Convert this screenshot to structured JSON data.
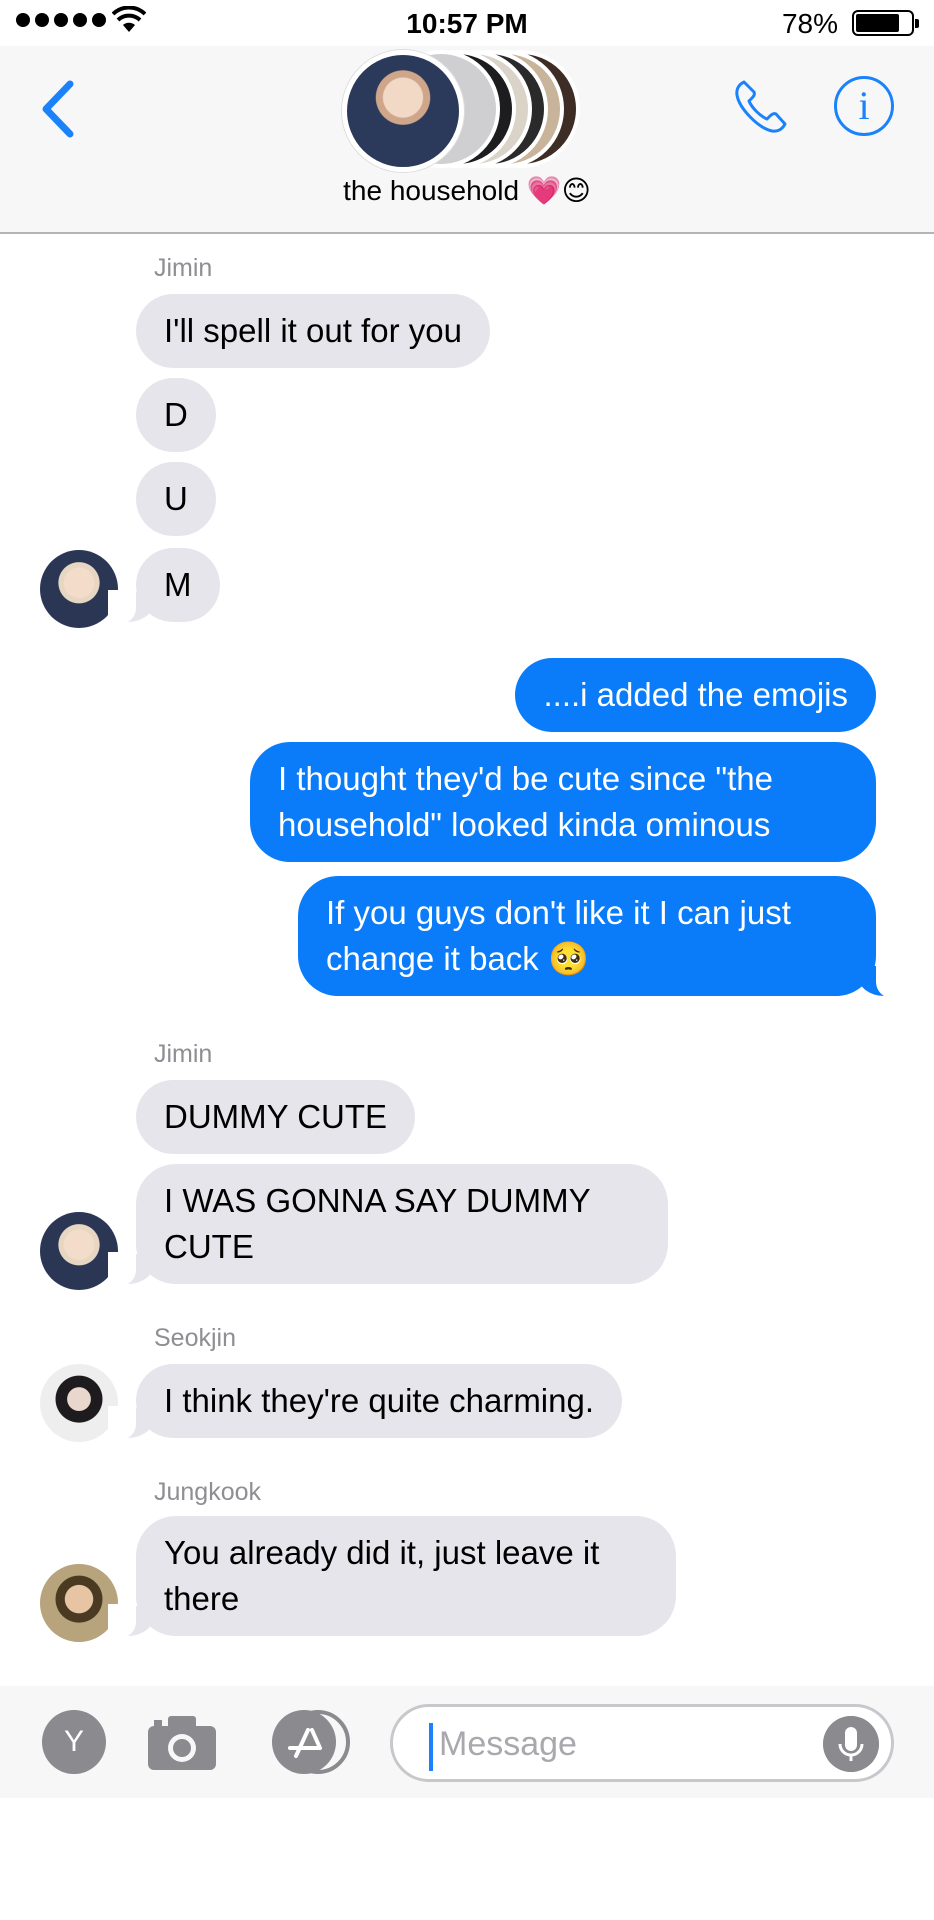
{
  "status_bar": {
    "time": "10:57 PM",
    "battery_percent": "78%",
    "battery_level": 0.78,
    "signal_bars": 5
  },
  "header": {
    "group_name": "the household 💗😊",
    "icons": {
      "back": "chevron-left-icon",
      "call": "phone-icon",
      "info": "info-icon"
    },
    "accent_color": "#1a82fb"
  },
  "messages": [
    {
      "sender": "Jimin",
      "direction": "incoming",
      "text": "I'll spell it out for you"
    },
    {
      "sender": "Jimin",
      "direction": "incoming",
      "text": "D"
    },
    {
      "sender": "Jimin",
      "direction": "incoming",
      "text": "U"
    },
    {
      "sender": "Jimin",
      "direction": "incoming",
      "text": "M"
    },
    {
      "sender": "me",
      "direction": "outgoing",
      "text": "....i added the emojis"
    },
    {
      "sender": "me",
      "direction": "outgoing",
      "text": "I thought they'd be cute since \"the household\" looked kinda ominous"
    },
    {
      "sender": "me",
      "direction": "outgoing",
      "text": "If you guys don't like it I can just change it back 🥺"
    },
    {
      "sender": "Jimin",
      "direction": "incoming",
      "text": "DUMMY CUTE"
    },
    {
      "sender": "Jimin",
      "direction": "incoming",
      "text": "I WAS GONNA SAY DUMMY CUTE"
    },
    {
      "sender": "Seokjin",
      "direction": "incoming",
      "text": "I think they're quite charming."
    },
    {
      "sender": "Jungkook",
      "direction": "incoming",
      "text": "You already did it, just leave it there"
    }
  ],
  "sender_labels": {
    "jimin_1": "Jimin",
    "jimin_2": "Jimin",
    "seokjin": "Seokjin",
    "jungkook": "Jungkook"
  },
  "composer": {
    "y_button": "Y",
    "placeholder": "Message",
    "icons": {
      "camera": "camera-icon",
      "appstore": "appstore-icon",
      "mic": "microphone-icon"
    }
  },
  "colors": {
    "outgoing_bubble": "#0a7cfa",
    "incoming_bubble": "#e6e5eb",
    "sender_label": "#8e8e93"
  }
}
